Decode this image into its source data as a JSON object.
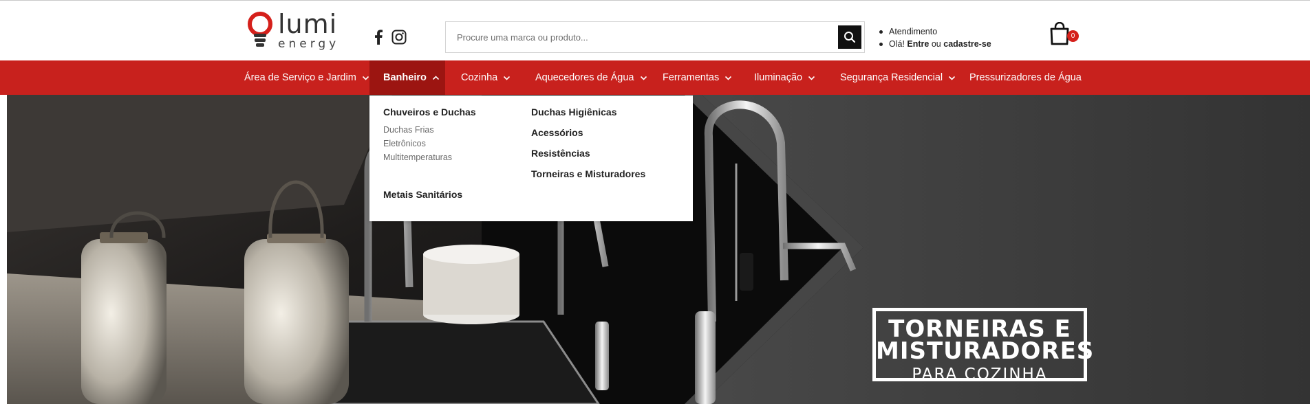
{
  "brand": {
    "name": "lumi",
    "tagline": "energy",
    "accent": "#c8211d"
  },
  "social": {
    "facebook_icon": "facebook-icon",
    "instagram_icon": "instagram-icon"
  },
  "search": {
    "placeholder": "Procure uma marca ou produto...",
    "value": ""
  },
  "account": {
    "service_label": "Atendimento",
    "greeting": "Olá!",
    "login_label": "Entre",
    "or_text": "ou",
    "signup_label": "cadastre-se"
  },
  "cart": {
    "count": "0"
  },
  "nav": {
    "items": [
      {
        "label": "Área de Serviço e Jardim"
      },
      {
        "label": "Banheiro"
      },
      {
        "label": "Cozinha"
      },
      {
        "label": "Aquecedores de Água"
      },
      {
        "label": "Ferramentas"
      },
      {
        "label": "Iluminação"
      },
      {
        "label": "Segurança Residencial"
      },
      {
        "label": "Pressurizadores de Água"
      }
    ],
    "active": "Banheiro"
  },
  "dropdown": {
    "col1": {
      "heading": "Chuveiros e Duchas",
      "subitems": [
        "Duchas Frias",
        "Eletrônicos",
        "Multitemperaturas"
      ],
      "heading2": "Metais Sanitários"
    },
    "col2": [
      "Duchas Higiênicas",
      "Acessórios",
      "Resistências",
      "Torneiras e Misturadores"
    ]
  },
  "hero": {
    "line1": "TORNEIRAS E",
    "line2": "MISTURADORES",
    "line3": "PARA COZINHA"
  }
}
